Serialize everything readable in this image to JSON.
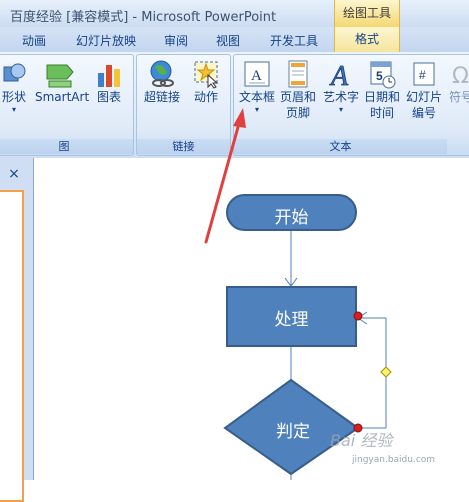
{
  "window": {
    "title": "百度经验 [兼容模式] - Microsoft PowerPoint",
    "context_header": "绘图工具"
  },
  "tabs": [
    {
      "label": "动画"
    },
    {
      "label": "幻灯片放映"
    },
    {
      "label": "审阅"
    },
    {
      "label": "视图"
    },
    {
      "label": "开发工具"
    },
    {
      "label": "格式"
    }
  ],
  "ribbon": {
    "illustrations": {
      "group_label": "图",
      "shapes_label": "形状",
      "smartart_label": "SmartArt",
      "chart_label": "图表"
    },
    "links": {
      "group_label": "链接",
      "hyperlink_label": "超链接",
      "action_label": "动作"
    },
    "text": {
      "group_label": "文本",
      "textbox_label": "文本框",
      "header_footer_line1": "页眉和",
      "header_footer_line2": "页脚",
      "wordart_label": "艺术字",
      "datetime_line1": "日期和",
      "datetime_line2": "时间",
      "slidenum_line1": "幻灯片",
      "slidenum_line2": "编号",
      "symbol_label": "符号",
      "datetime_icon_digit": "5",
      "slidenum_icon_text": "#"
    }
  },
  "side_panel": {
    "close_symbol": "×"
  },
  "slide": {
    "shapes": {
      "start": "开始",
      "process": "处理",
      "decision": "判定"
    },
    "watermark": "Bai 经验",
    "watermark_sub": "jingyan.baidu.com"
  },
  "colors": {
    "shape_fill": "#4f81bd",
    "shape_border": "#385d8a",
    "arrow_red": "#e0413f",
    "ribbon_text": "#15428b",
    "context_tab": "#f4d872"
  }
}
